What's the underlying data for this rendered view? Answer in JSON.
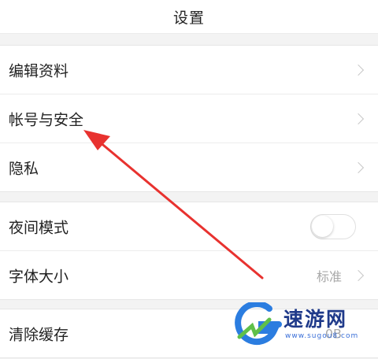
{
  "header": {
    "title": "设置"
  },
  "groups": [
    {
      "items": [
        {
          "label": "编辑资料"
        },
        {
          "label": "帐号与安全"
        },
        {
          "label": "隐私"
        }
      ]
    },
    {
      "items": [
        {
          "label": "夜间模式",
          "toggle_on": false
        },
        {
          "label": "字体大小",
          "value": "标准"
        }
      ]
    },
    {
      "items": [
        {
          "label": "清除缓存",
          "value": "0B"
        }
      ]
    }
  ],
  "annotation": {
    "arrow_color": "#e8322f"
  },
  "watermark": {
    "name": "速游网",
    "url": "www.sugou8.com",
    "brand_color": "#1f3a8a"
  }
}
